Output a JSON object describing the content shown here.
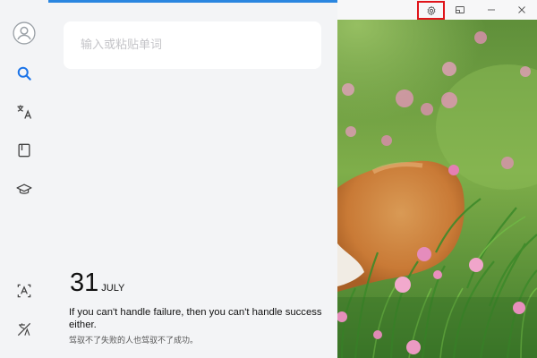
{
  "window": {
    "settings_icon": "gear-icon",
    "minimize_icon": "minimize-icon",
    "pin_icon": "picture-in-picture-icon",
    "close_icon": "close-icon"
  },
  "sidebar": {
    "items": [
      {
        "icon": "avatar-icon"
      },
      {
        "icon": "search-icon",
        "active": true
      },
      {
        "icon": "translate-icon"
      },
      {
        "icon": "notebook-icon"
      },
      {
        "icon": "graduation-cap-icon"
      },
      {
        "icon": "image-text-icon"
      },
      {
        "icon": "screen-translate-icon"
      }
    ]
  },
  "search": {
    "placeholder": "输入或粘贴单词",
    "value": ""
  },
  "daily": {
    "day": "31",
    "month": "JULY",
    "quote_en": "If you can't handle failure, then you can't handle success either.",
    "quote_zh": "驾驭不了失败的人也驾驭不了成功。"
  },
  "colors": {
    "accent": "#2a86e0",
    "highlight": "#e0141a",
    "sidebar_bg": "#f3f4f6"
  }
}
